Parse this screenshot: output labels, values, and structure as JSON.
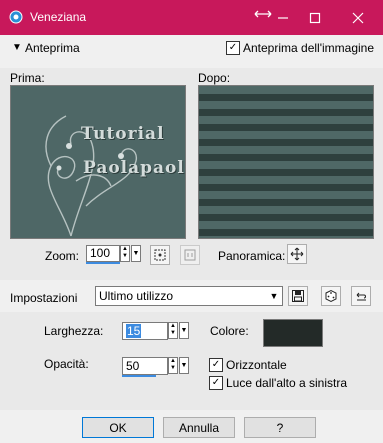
{
  "window": {
    "title": "Veneziana"
  },
  "header": {
    "preview_toggle_label": "Anteprima",
    "preview_image_checkbox_label": "Anteprima dell'immagine"
  },
  "preview": {
    "before_label": "Prima:",
    "after_label": "Dopo:",
    "watermark_line1": "Tutorial",
    "watermark_line2": "Paolapaola"
  },
  "zoom": {
    "label": "Zoom:",
    "value": "100"
  },
  "panoramica": {
    "label": "Panoramica:"
  },
  "presets": {
    "label": "Impostazioni",
    "selected": "Ultimo utilizzo"
  },
  "params": {
    "width_label": "Larghezza:",
    "width_value": "15",
    "opacity_label": "Opacità:",
    "opacity_value": "50",
    "color_label": "Colore:",
    "color_value": "#232a28",
    "horizontal_label": "Orizzontale",
    "light_label": "Luce dall'alto a sinistra"
  },
  "buttons": {
    "ok": "OK",
    "cancel": "Annulla",
    "help": "?"
  },
  "colors": {
    "titlebar": "#c8185b",
    "preview_bg": "#4e6766",
    "accent": "#3c8be0"
  }
}
